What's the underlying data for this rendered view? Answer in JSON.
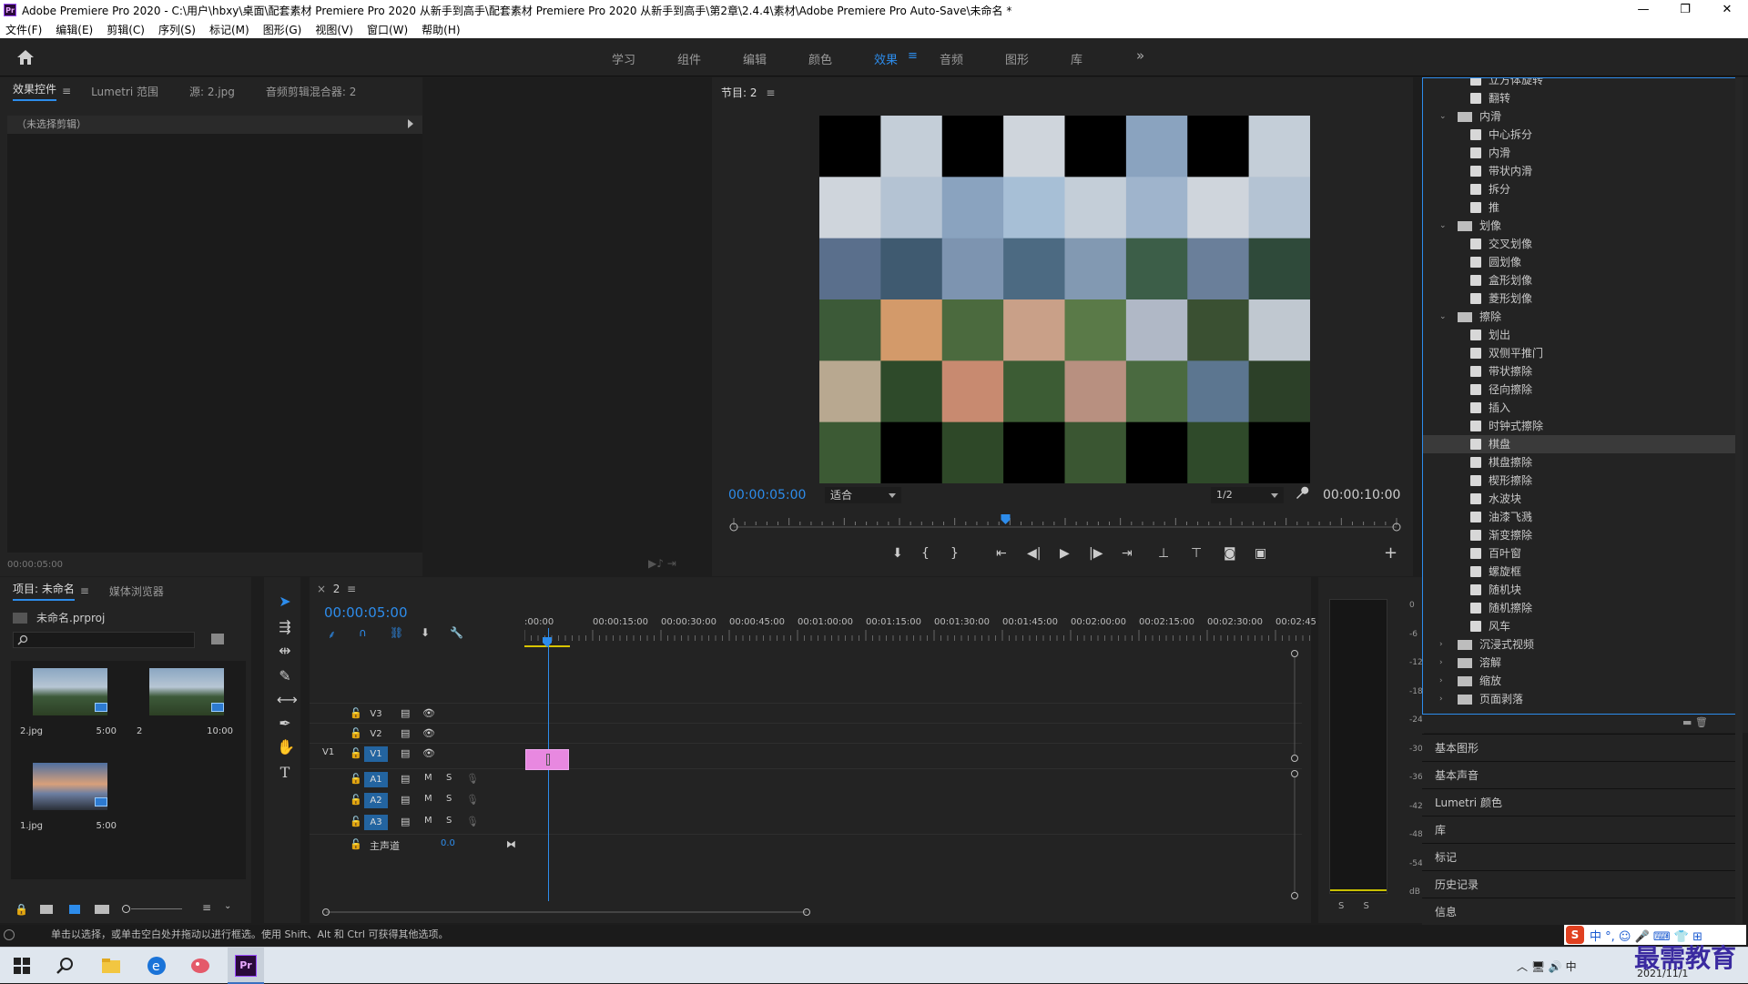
{
  "window": {
    "title": "Adobe Premiere Pro 2020 - C:\\用户\\hbxy\\桌面\\配套素材 Premiere Pro 2020 从新手到高手\\配套素材 Premiere Pro 2020 从新手到高手\\第2章\\2.4.4\\素材\\Adobe Premiere Pro Auto-Save\\未命名 *",
    "logo": "Pr",
    "controls": [
      "—",
      "❐",
      "✕"
    ]
  },
  "menu": [
    "文件(F)",
    "编辑(E)",
    "剪辑(C)",
    "序列(S)",
    "标记(M)",
    "图形(G)",
    "视图(V)",
    "窗口(W)",
    "帮助(H)"
  ],
  "workspaces": {
    "tabs": [
      "学习",
      "组件",
      "编辑",
      "颜色",
      "效果",
      "音频",
      "图形",
      "库"
    ],
    "active": "效果",
    "more": "»"
  },
  "effect_controls": {
    "tabs": [
      "效果控件",
      "Lumetri 范围",
      "源: 2.jpg",
      "音频剪辑混合器: 2"
    ],
    "no_clip": "（未选择剪辑）",
    "timecode": "00:00:05:00"
  },
  "program_monitor": {
    "title": "节目: 2",
    "timecode": "00:00:05:00",
    "fit": "适合",
    "resolution": "1/2",
    "duration": "00:00:10:00",
    "playhead_fraction": 0.41
  },
  "project": {
    "tabs": [
      "项目: 未命名",
      "媒体浏览器"
    ],
    "file": "未命名.prproj",
    "items": [
      {
        "name": "2.jpg",
        "duration": "5:00"
      },
      {
        "name": "2",
        "duration": "10:00"
      },
      {
        "name": "1.jpg",
        "duration": "5:00"
      }
    ]
  },
  "timeline": {
    "tab": "2",
    "timecode": "00:00:05:00",
    "ruler": [
      ":00:00",
      "00:00:15:00",
      "00:00:30:00",
      "00:00:45:00",
      "00:01:00:00",
      "00:01:15:00",
      "00:01:30:00",
      "00:01:45:00",
      "00:02:00:00",
      "00:02:15:00",
      "00:02:30:00",
      "00:02:45:"
    ],
    "video_tracks": [
      "V3",
      "V2",
      "V1"
    ],
    "v1_source": "V1",
    "audio_tracks": [
      "A1",
      "A2",
      "A3"
    ],
    "mute": "M",
    "solo": "S",
    "master": "主声道",
    "master_value": "0.0"
  },
  "meter": {
    "scale": [
      "0",
      "-6",
      "-12",
      "-18",
      "-24",
      "-30",
      "-36",
      "-42",
      "-48",
      "-54",
      "dB"
    ],
    "solo": "S S"
  },
  "effects_tree": [
    {
      "level": 2,
      "type": "item",
      "label": "立方体旋转"
    },
    {
      "level": 2,
      "type": "item",
      "label": "翻转"
    },
    {
      "level": 1,
      "type": "folder",
      "label": "内滑",
      "open": true
    },
    {
      "level": 2,
      "type": "item",
      "label": "中心拆分"
    },
    {
      "level": 2,
      "type": "item",
      "label": "内滑"
    },
    {
      "level": 2,
      "type": "item",
      "label": "带状内滑"
    },
    {
      "level": 2,
      "type": "item",
      "label": "拆分"
    },
    {
      "level": 2,
      "type": "item",
      "label": "推"
    },
    {
      "level": 1,
      "type": "folder",
      "label": "划像",
      "open": true
    },
    {
      "level": 2,
      "type": "item",
      "label": "交叉划像"
    },
    {
      "level": 2,
      "type": "item",
      "label": "圆划像"
    },
    {
      "level": 2,
      "type": "item",
      "label": "盒形划像"
    },
    {
      "level": 2,
      "type": "item",
      "label": "菱形划像"
    },
    {
      "level": 1,
      "type": "folder",
      "label": "擦除",
      "open": true
    },
    {
      "level": 2,
      "type": "item",
      "label": "划出"
    },
    {
      "level": 2,
      "type": "item",
      "label": "双侧平推门"
    },
    {
      "level": 2,
      "type": "item",
      "label": "带状擦除"
    },
    {
      "level": 2,
      "type": "item",
      "label": "径向擦除"
    },
    {
      "level": 2,
      "type": "item",
      "label": "插入"
    },
    {
      "level": 2,
      "type": "item",
      "label": "时钟式擦除"
    },
    {
      "level": 2,
      "type": "item",
      "label": "棋盘",
      "selected": true
    },
    {
      "level": 2,
      "type": "item",
      "label": "棋盘擦除"
    },
    {
      "level": 2,
      "type": "item",
      "label": "楔形擦除"
    },
    {
      "level": 2,
      "type": "item",
      "label": "水波块"
    },
    {
      "level": 2,
      "type": "item",
      "label": "油漆飞溅"
    },
    {
      "level": 2,
      "type": "item",
      "label": "渐变擦除"
    },
    {
      "level": 2,
      "type": "item",
      "label": "百叶窗"
    },
    {
      "level": 2,
      "type": "item",
      "label": "螺旋框"
    },
    {
      "level": 2,
      "type": "item",
      "label": "随机块"
    },
    {
      "level": 2,
      "type": "item",
      "label": "随机擦除"
    },
    {
      "level": 2,
      "type": "item",
      "label": "风车"
    },
    {
      "level": 1,
      "type": "folder",
      "label": "沉浸式视频",
      "open": false
    },
    {
      "level": 1,
      "type": "folder",
      "label": "溶解",
      "open": false
    },
    {
      "level": 1,
      "type": "folder",
      "label": "缩放",
      "open": false
    },
    {
      "level": 1,
      "type": "folder",
      "label": "页面剥落",
      "open": false
    }
  ],
  "side_panels": [
    "基本图形",
    "基本声音",
    "Lumetri 颜色",
    "库",
    "标记",
    "历史记录",
    "信息"
  ],
  "status": "单击以选择，或单击空白处并拖动以进行框选。使用 Shift、Alt 和 Ctrl 可获得其他选项。",
  "taskbar": {
    "date": "2021/11/1",
    "pr": "Pr"
  },
  "ime": {
    "logo": "S",
    "label": "中 °, ☺ 🎤 ⌨ 👕 ⊞"
  },
  "watermark": "最需教育",
  "colors": {
    "accent": "#2d8ceb",
    "clip": "#e888e0",
    "panel": "#232323"
  }
}
